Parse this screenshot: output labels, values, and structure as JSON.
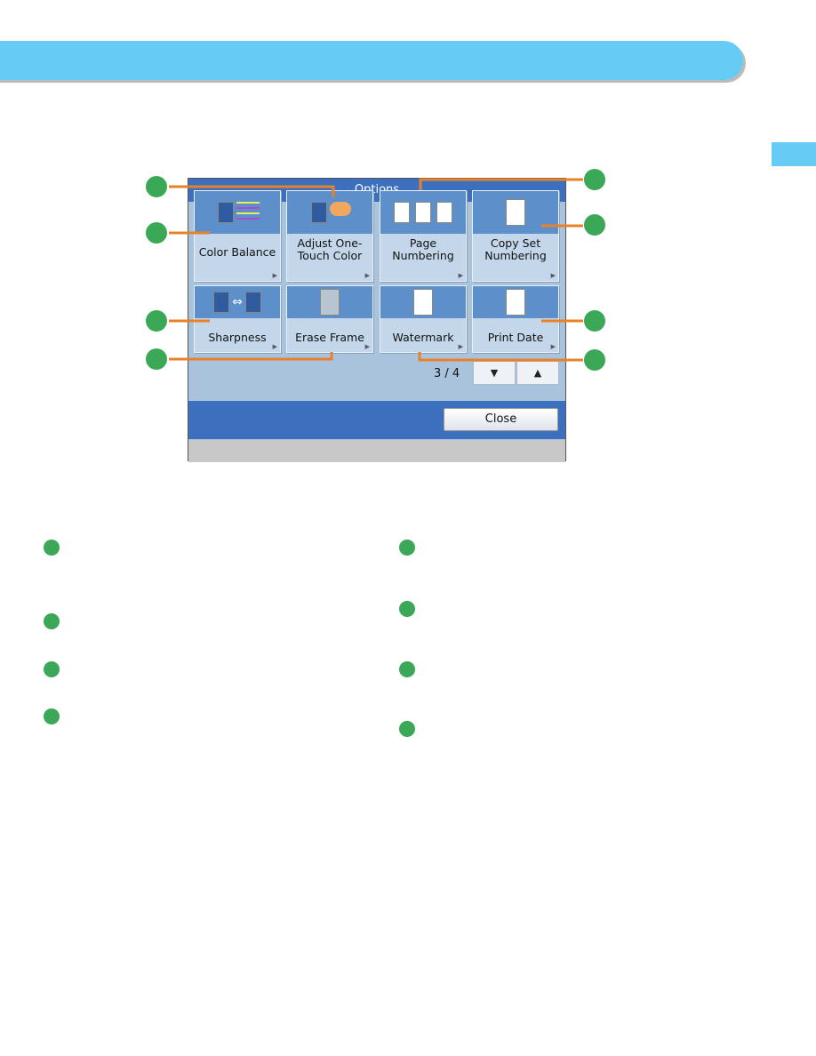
{
  "screen": {
    "title": "Options",
    "buttons": [
      {
        "label": "Color Balance",
        "icon": "color-balance-icon"
      },
      {
        "label": "Adjust One-Touch Color",
        "icon": "adjust-color-hand-icon"
      },
      {
        "label": "Page Numbering",
        "icon": "page-numbering-icon"
      },
      {
        "label": "Copy Set Numbering",
        "icon": "copy-set-numbering-icon"
      },
      {
        "label": "Sharpness",
        "icon": "sharpness-icon"
      },
      {
        "label": "Erase Frame",
        "icon": "erase-frame-icon"
      },
      {
        "label": "Watermark",
        "icon": "watermark-icon"
      },
      {
        "label": "Print Date",
        "icon": "print-date-icon"
      }
    ],
    "pager": "3 / 4",
    "down_label": "▼",
    "up_label": "▲",
    "close_label": "Close"
  },
  "colors": {
    "banner": "#66ccf5",
    "callout_line": "#e8822a",
    "callout_dot": "#3aa857",
    "screen_blue": "#3d6fbf"
  }
}
